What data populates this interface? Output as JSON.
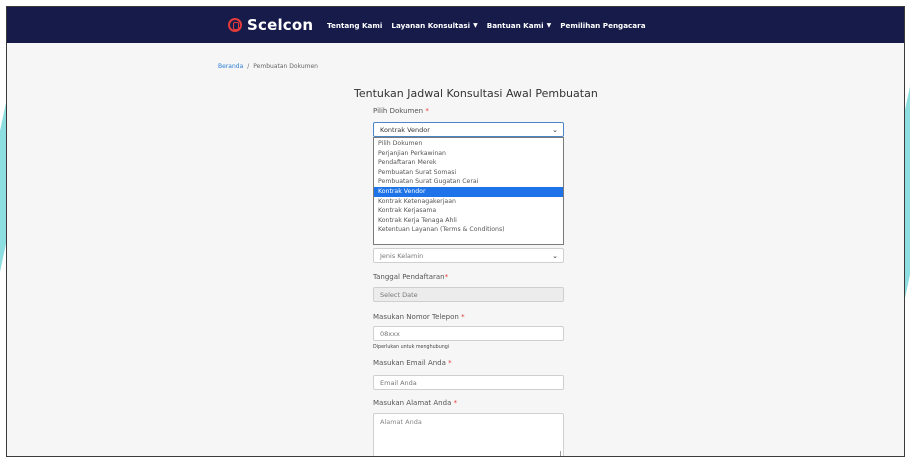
{
  "brand": {
    "name": "Scelcon"
  },
  "nav": {
    "items": [
      {
        "label": "Tentang Kami",
        "dropdown": false
      },
      {
        "label": "Layanan Konsultasi",
        "dropdown": true
      },
      {
        "label": "Bantuan Kami",
        "dropdown": true
      },
      {
        "label": "Pemilihan Pengacara",
        "dropdown": false
      }
    ]
  },
  "breadcrumb": {
    "home": "Beranda",
    "separator": "/",
    "current": "Pembuatan Dokumen"
  },
  "form": {
    "title": "Tentukan Jadwal Konsultasi Awal Pembuatan",
    "document": {
      "label": "Pilih Dokumen",
      "required_mark": "*",
      "value": "Kontrak Vendor",
      "options": [
        "Pilih Dokumen",
        "Perjanjian Perkawinan",
        "Pendaftaran Merek",
        "Pembuatan Surat Somasi",
        "Pembuatan Surat Gugatan Cerai",
        "Kontrak Vendor",
        "Kontrak Ketenagakerjaan",
        "Kontrak Kerjasama",
        "Kontrak Kerja Tenaga Ahli",
        "Ketentuan Layanan (Terms & Conditions)"
      ],
      "selected_index": 5
    },
    "gender": {
      "value": "Jenis Kelamin"
    },
    "date": {
      "label": "Tanggal Pendaftaran",
      "required_mark": "*",
      "placeholder": "Select Date"
    },
    "phone": {
      "label": "Masukan Nomor Telepon",
      "required_mark": "*",
      "placeholder": "08xxx",
      "helper": "Diperlukan untuk menghubungi"
    },
    "email": {
      "label": "Masukan Email Anda",
      "required_mark": "*",
      "placeholder": "Email Anda"
    },
    "address": {
      "label": "Masukan Alamat Anda",
      "required_mark": "*",
      "placeholder": "Alamat Anda"
    }
  },
  "colors": {
    "navbar": "#161b4a",
    "accent": "#2fc3c8",
    "selected_option": "#1e73e8",
    "required": "#e23b3b"
  },
  "icons": {
    "logo": "shield-logo-icon",
    "dropdown": "chevron-down-icon",
    "nav_caret": "caret-down-icon"
  }
}
